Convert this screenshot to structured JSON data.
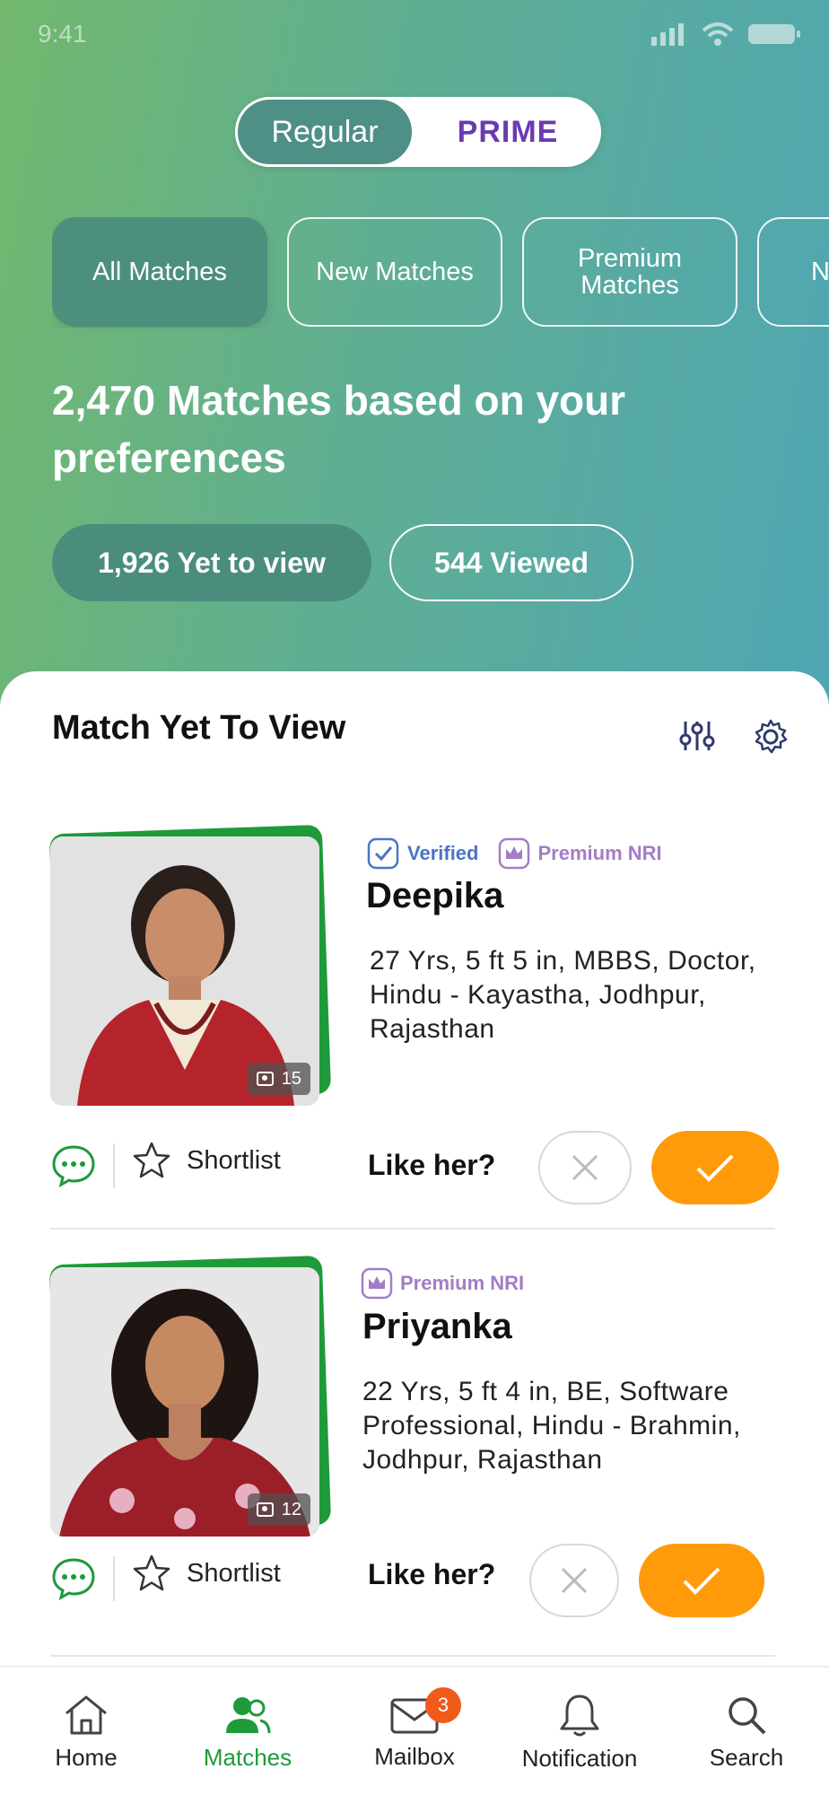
{
  "status_bar": {
    "time": "9:41"
  },
  "mode_toggle": {
    "regular": "Regular",
    "prime": "PRIME"
  },
  "filters": [
    "All Matches",
    "New Matches",
    "Premium Matches",
    "N M"
  ],
  "headline": "2,470 Matches based on your preferences",
  "view_pills": {
    "yet_to_view": "1,926 Yet to view",
    "viewed": "544 Viewed"
  },
  "section": {
    "title": "Match Yet To View"
  },
  "profiles": [
    {
      "verified": "Verified",
      "premium": "Premium NRI",
      "name": "Deepika",
      "details": "27 Yrs, 5 ft 5 in, MBBS, Doctor, Hindu - Kayastha, Jodhpur, Rajasthan",
      "photo_count": "15",
      "shortlist": "Shortlist",
      "like_question": "Like her?"
    },
    {
      "premium": "Premium NRI",
      "name": "Priyanka",
      "details": "22 Yrs, 5 ft 4 in, BE, Software Professional, Hindu - Brahmin, Jodhpur, Rajasthan",
      "photo_count": "12",
      "shortlist": "Shortlist",
      "like_question": "Like her?"
    }
  ],
  "bottom_nav": {
    "home": "Home",
    "matches": "Matches",
    "mailbox": "Mailbox",
    "mailbox_badge": "3",
    "notification": "Notification",
    "search": "Search"
  },
  "colors": {
    "accent_green": "#1f9a3a",
    "like_orange": "#ff9a0a",
    "prime_purple": "#6a3bb0"
  }
}
